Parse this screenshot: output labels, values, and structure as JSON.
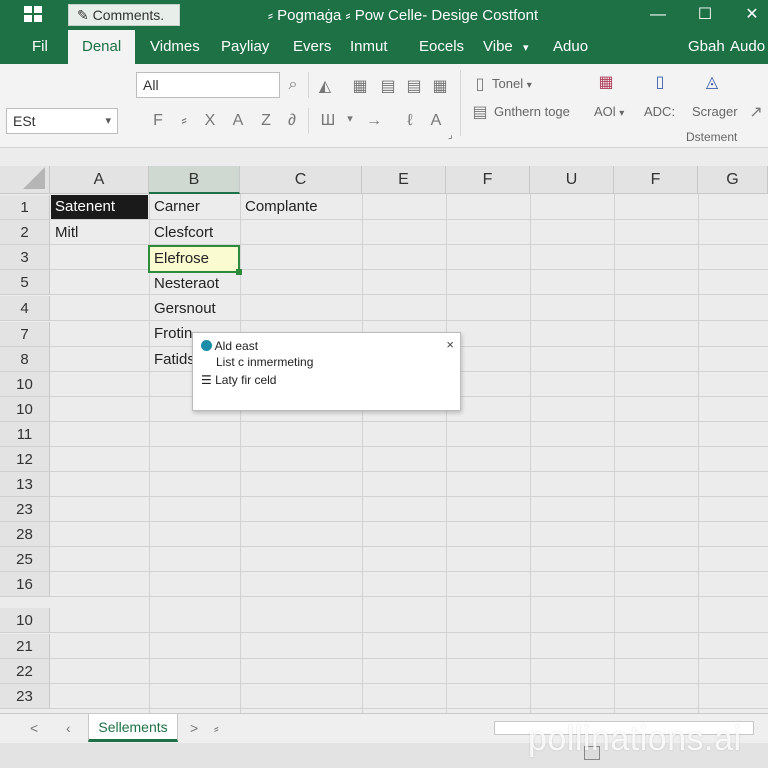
{
  "title_bar": {
    "comments_label": "Comments.",
    "title": "⸗ Pogmaġa ⸗ Pow Celle- Desige Costfont",
    "minimize": "—",
    "maximize": "☐",
    "close": "✕"
  },
  "menu": {
    "items": [
      "Fil",
      "Denal",
      "Vidmes",
      "Payliay",
      "Evers",
      "Inmut",
      "Eocels",
      "Vibe",
      "Aduo",
      "Gbah",
      "Audo"
    ],
    "vibe_caret": "▾"
  },
  "ribbon": {
    "font_field": "All",
    "name_box": "ESt",
    "tonel_label": "Tonel",
    "tonel_caret": "▾",
    "gnthern_label": "Gnthern toge",
    "aol_label": "AOl",
    "aol_caret": "▾",
    "adc_label": "ADC:",
    "scrager_label": "Scrager",
    "group_label": "Dstement",
    "format_icons": [
      "F",
      "⸗",
      "X",
      "A",
      "Z",
      "∂"
    ],
    "paste_icons": [
      "Ш",
      "▾",
      "→",
      "ℓ",
      "A"
    ]
  },
  "columns": [
    "A",
    "B",
    "C",
    "E",
    "F",
    "U",
    "F",
    "G"
  ],
  "rows": [
    "1",
    "2",
    "3",
    "5",
    "4",
    "7",
    "8",
    "10",
    "10",
    "11",
    "12",
    "13",
    "23",
    "28",
    "25",
    "16",
    "10",
    "21",
    "22",
    "23"
  ],
  "cells": {
    "a1": "Satenent",
    "b1": "Carner",
    "c1": "Complante",
    "a2": "Mitl",
    "b2": "Clesfcort",
    "b3": "Elefrose",
    "b5": "Nesteraot",
    "b4": "Gersnout",
    "b7": "Frotin",
    "b8": "Fatids"
  },
  "popup": {
    "line1": "Ald east",
    "line2": "List c inmermeting",
    "line3": "Laty fir celd",
    "close": "×"
  },
  "sheet_tabs": {
    "nav_left": "<",
    "nav_left2": "‹",
    "active_tab": "Sellements",
    "nav_right": ">",
    "add": "⸗"
  },
  "watermark": "pollinations.ai",
  "colors": {
    "brand": "#1e7145",
    "active_cell": "#fafbd0",
    "dark_cell": "#1a1a1a"
  }
}
